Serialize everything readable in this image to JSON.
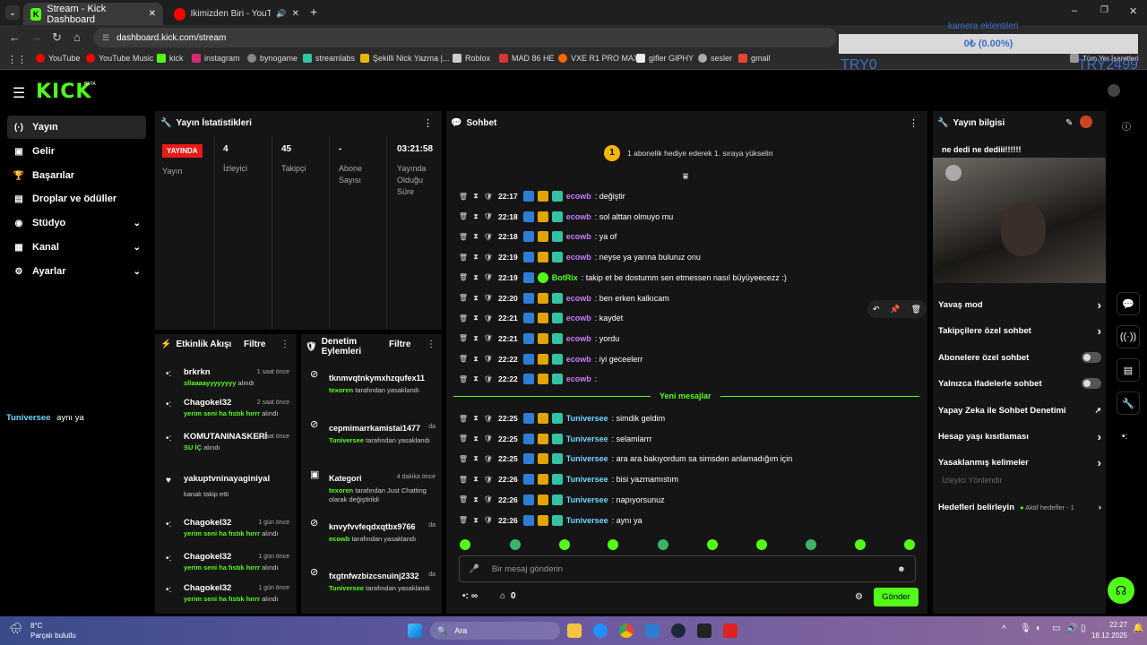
{
  "browser": {
    "tabs": [
      {
        "title": "Stream - Kick Dashboard",
        "active": true
      },
      {
        "title": "İkimizden Biri - YouTube Mu",
        "active": false
      }
    ],
    "new_tab": "+",
    "url": "dashboard.kick.com/stream",
    "bookmarks": [
      "YouTube",
      "YouTube Music",
      "kick",
      "instagram",
      "bynogame",
      "streamlabs",
      "Şekilli Nick Yazma |...",
      "Roblox",
      "MAD 86 HE",
      "VXE R1 PRO MAX",
      "gifler GIPHY",
      "sesler",
      "gmail",
      "Tüm Yer İşaretleri"
    ],
    "window_controls": [
      "–",
      "❐",
      "✕"
    ]
  },
  "overlay": {
    "kamera": "kamera eklentileri",
    "amount": "0₺ (0.00%)",
    "left": "TRY0",
    "right": "TRY2499"
  },
  "sidebar": {
    "logo": "KICK",
    "logo_badge": "BETA",
    "items": [
      {
        "label": "Yayın",
        "icon": "(·)",
        "active": true,
        "chevron": false
      },
      {
        "label": "Gelir",
        "icon": "▣",
        "chevron": false
      },
      {
        "label": "Başarılar",
        "icon": "🏆",
        "chevron": false
      },
      {
        "label": "Droplar ve ödüller",
        "icon": "▤",
        "chevron": false
      },
      {
        "label": "Stüdyo",
        "icon": "◉",
        "chevron": true
      },
      {
        "label": "Kanal",
        "icon": "▦",
        "chevron": true
      },
      {
        "label": "Ayarlar",
        "icon": "⚙",
        "chevron": true
      }
    ],
    "floating_chat": {
      "user": "Tuniversee",
      "text": "aynı ya"
    }
  },
  "stats": {
    "title": "Yayın İstatistikleri",
    "live_badge": "YAYINDA",
    "live_label": "Yayın",
    "viewers": {
      "value": "4",
      "label": "İzleyici"
    },
    "followers": {
      "value": "45",
      "label": "Takipçi"
    },
    "subs": {
      "value": "-",
      "label": "Abone Sayısı"
    },
    "duration": {
      "value": "03:21:58",
      "label": "Yayında Olduğu Süre"
    }
  },
  "activity": {
    "title": "Etkinlik Akışı",
    "filter": "Filtre",
    "events": [
      {
        "name": "brkrkn",
        "time": "1 saat önce",
        "msg": "sllaaaayyyyyyyy",
        "suffix": "alındı",
        "icon": "•:"
      },
      {
        "name": "Chagokel32",
        "time": "2 saat önce",
        "msg": "yerim seni ha fıstık hırrr",
        "suffix": "alındı",
        "icon": "•:"
      },
      {
        "name": "KOMUTANINASKERİ",
        "time": "2 saat önce",
        "msg": "SU İÇ",
        "suffix": "alındı",
        "icon": "•:"
      },
      {
        "name": "yakuptvninayaginiyalayan",
        "time": "",
        "msg": "",
        "suffix": "kanalı takip etti",
        "icon": "♥"
      },
      {
        "name": "Chagokel32",
        "time": "1 gün önce",
        "msg": "yerim seni ha fıstık hırrr",
        "suffix": "alındı",
        "icon": "•:"
      },
      {
        "name": "Chagokel32",
        "time": "1 gün önce",
        "msg": "yerim seni ha fıstık hırrr",
        "suffix": "alındı",
        "icon": "•:"
      },
      {
        "name": "Chagokel32",
        "time": "1 gün önce",
        "msg": "yerim seni ha fıstık hırrr",
        "suffix": "alındı",
        "icon": "•:"
      }
    ]
  },
  "moderation": {
    "title": "Denetim Eylemleri",
    "filter": "Filtre",
    "items": [
      {
        "target": "tknmvqtnkymxhzqufex11",
        "time": "",
        "actor": "texoren",
        "action": "tarafından yasaklandı"
      },
      {
        "target": "cepmimarrkamistai1477",
        "time": "da",
        "actor": "Tuniversee",
        "action": "tarafından yasaklandı"
      },
      {
        "target": "Kategori",
        "time": "4 dakika önce",
        "actor": "texoren",
        "action": "tarafından Just Chatting olarak değiştirildi"
      },
      {
        "target": "knvyfvvfeqdxqtbx9766",
        "time": "da",
        "actor": "ecowb",
        "action": "tarafından yasaklandı"
      },
      {
        "target": "fxgtnfwzbizcsnuinj2332",
        "time": "da",
        "actor": "Tuniversee",
        "action": "tarafından yasaklandı"
      }
    ]
  },
  "chat": {
    "title": "Sohbet",
    "pinned": "1 abonelik hediye ederek 1. sıraya yükselin",
    "pinned_rank": "1",
    "messages": [
      {
        "time": "22:17",
        "user": "ecowb",
        "text": ": değiştir",
        "color": "#c77dff"
      },
      {
        "time": "22:18",
        "user": "ecowb",
        "text": ": sol alttan olmuyo mu",
        "color": "#c77dff"
      },
      {
        "time": "22:18",
        "user": "ecowb",
        "text": ": ya of",
        "color": "#c77dff"
      },
      {
        "time": "22:19",
        "user": "ecowb",
        "text": ": neyse ya yarına buluruz onu",
        "color": "#c77dff"
      },
      {
        "time": "22:19",
        "user": "BotRix",
        "text": ": takip et be dostumm sen etmessen nasıl büyüyeecezz :)",
        "color": "#53fc18"
      },
      {
        "time": "22:20",
        "user": "ecowb",
        "text": ": ben erken kalkıcam",
        "color": "#c77dff"
      },
      {
        "time": "22:21",
        "user": "ecowb",
        "text": ": kaydet",
        "color": "#c77dff"
      },
      {
        "time": "22:21",
        "user": "ecowb",
        "text": ": yordu",
        "color": "#c77dff"
      },
      {
        "time": "22:22",
        "user": "ecowb",
        "text": ": iyi geceelerr",
        "color": "#c77dff"
      },
      {
        "time": "22:22",
        "user": "ecowb",
        "text": ":",
        "color": "#c77dff"
      }
    ],
    "new_divider": "Yeni mesajlar",
    "new_messages": [
      {
        "time": "22:25",
        "user": "Tuniversee",
        "text": ": simdik geldim",
        "color": "#70d6ff"
      },
      {
        "time": "22:25",
        "user": "Tuniversee",
        "text": ": selamlarrr",
        "color": "#70d6ff"
      },
      {
        "time": "22:25",
        "user": "Tuniversee",
        "text": ": ara ara bakıyordum sa simsden anlamadığım için",
        "color": "#70d6ff"
      },
      {
        "time": "22:26",
        "user": "Tuniversee",
        "text": ": bisi yazmamıstım",
        "color": "#70d6ff"
      },
      {
        "time": "22:26",
        "user": "Tuniversee",
        "text": ": napıyorsunuz",
        "color": "#70d6ff"
      },
      {
        "time": "22:26",
        "user": "Tuniversee",
        "text": ": aynı ya",
        "color": "#70d6ff"
      }
    ],
    "input_placeholder": "Bir mesaj gönderin",
    "points": "∞",
    "store_count": "0",
    "send": "Gönder"
  },
  "stream_info": {
    "title": "Yayın bilgisi",
    "stream_title": "ne dedi ne dediii!!!!!!",
    "settings": [
      {
        "label": "Yavaş mod",
        "control": "chevron"
      },
      {
        "label": "Takipçilere özel sohbet",
        "control": "chevron"
      },
      {
        "label": "Abonelere özel sohbet",
        "control": "toggle"
      },
      {
        "label": "Yalnızca ifadelerle sohbet",
        "control": "toggle"
      },
      {
        "label": "Yapay Zeka ile Sohbet Denetimi",
        "control": "external"
      },
      {
        "label": "Hesap yaşı kısıtlaması",
        "control": "chevron"
      },
      {
        "label": "Yasaklanmış kelimeler",
        "control": "chevron"
      }
    ],
    "section_label": "İzleyici Yönlendir",
    "goals": {
      "label": "Hedefleri belirleyin",
      "status": "Aktif hedefler - 1"
    }
  },
  "taskbar": {
    "temp": "8°C",
    "weather": "Parçalı bulutlu",
    "search": "Ara",
    "time": "22:27",
    "date": "18.12.2025"
  },
  "colors": {
    "accent": "#53fc18",
    "live": "#e91916",
    "panel": "#151515"
  }
}
